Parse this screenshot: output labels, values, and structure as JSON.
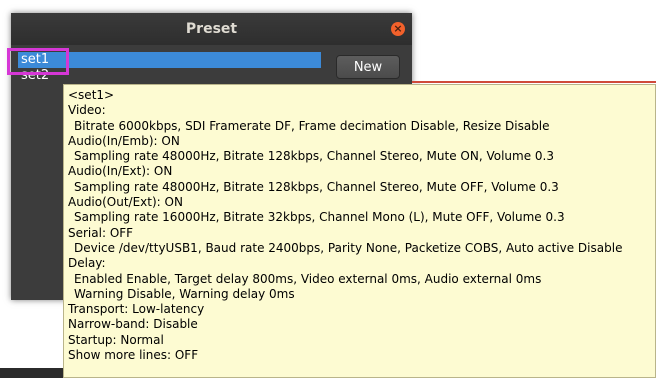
{
  "window": {
    "title": "Preset",
    "close_glyph": "×",
    "new_button": "New",
    "list_items": [
      {
        "label": "set1",
        "selected": true
      },
      {
        "label": "set2",
        "selected": false
      }
    ]
  },
  "tooltip": {
    "lines": [
      {
        "text": "<set1>",
        "indent": false
      },
      {
        "text": "Video:",
        "indent": false
      },
      {
        "text": "Bitrate 6000kbps, SDI Framerate DF, Frame decimation Disable, Resize Disable",
        "indent": true
      },
      {
        "text": "Audio(In/Emb): ON",
        "indent": false
      },
      {
        "text": "Sampling rate 48000Hz, Bitrate 128kbps, Channel Stereo, Mute ON, Volume 0.3",
        "indent": true
      },
      {
        "text": "Audio(In/Ext): ON",
        "indent": false
      },
      {
        "text": "Sampling rate 48000Hz, Bitrate 128kbps, Channel Stereo, Mute OFF, Volume 0.3",
        "indent": true
      },
      {
        "text": "Audio(Out/Ext): ON",
        "indent": false
      },
      {
        "text": "Sampling rate 16000Hz, Bitrate 32kbps, Channel Mono (L), Mute OFF, Volume 0.3",
        "indent": true
      },
      {
        "text": "Serial: OFF",
        "indent": false
      },
      {
        "text": "Device /dev/ttyUSB1, Baud rate 2400bps, Parity None, Packetize COBS, Auto active Disable",
        "indent": true
      },
      {
        "text": "Delay:",
        "indent": false
      },
      {
        "text": "Enabled Enable, Target delay 800ms, Video external 0ms, Audio external 0ms",
        "indent": true
      },
      {
        "text": "Warning Disable, Warning delay 0ms",
        "indent": true
      },
      {
        "text": "Transport: Low-latency",
        "indent": false
      },
      {
        "text": "Narrow-band: Disable",
        "indent": false
      },
      {
        "text": "Startup: Normal",
        "indent": false
      },
      {
        "text": "Show more lines: OFF",
        "indent": false
      }
    ]
  },
  "colors": {
    "selection": "#3c8ad8",
    "highlight_box": "#d637d6",
    "tooltip_bg": "#fdfbd2",
    "close_button": "#f2612b"
  }
}
